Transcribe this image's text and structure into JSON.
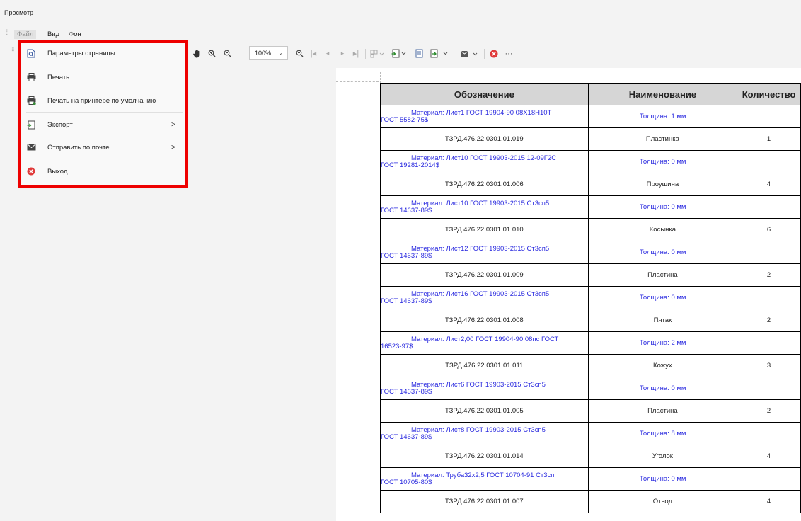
{
  "window": {
    "title": "Просмотр"
  },
  "menubar": {
    "file": "Файл",
    "view": "Вид",
    "background": "Фон"
  },
  "toolbar": {
    "zoom": "100%"
  },
  "file_menu": {
    "items": [
      {
        "label": "Параметры страницы...",
        "icon": "page-setup-icon"
      },
      {
        "label": "Печать...",
        "icon": "printer-icon"
      },
      {
        "label": "Печать на принтере по умолчанию",
        "icon": "default-printer-icon"
      },
      {
        "label": "Экспорт",
        "icon": "export-icon",
        "arrow": ">"
      },
      {
        "label": "Отправить по почте",
        "icon": "mail-icon",
        "arrow": ">"
      },
      {
        "label": "Выход",
        "icon": "exit-icon"
      }
    ]
  },
  "report": {
    "headers": {
      "designation": "Обозначение",
      "name": "Наименование",
      "quantity": "Количество"
    },
    "rows": [
      {
        "type": "material",
        "line1": "Материал: Лист1 ГОСТ 19904-90 08Х18Н10Т",
        "line2": "ГОСТ 5582-75$",
        "thickness": "Толщина: 1 мм"
      },
      {
        "type": "item",
        "code": "ТЗРД.476.22.0301.01.019",
        "name": "Пластинка",
        "qty": "1"
      },
      {
        "type": "material",
        "line1": "Материал: Лист10 ГОСТ 19903-2015 12-09Г2С",
        "line2": "ГОСТ 19281-2014$",
        "thickness": "Толщина: 0 мм"
      },
      {
        "type": "item",
        "code": "ТЗРД.476.22.0301.01.006",
        "name": "Проушина",
        "qty": "4"
      },
      {
        "type": "material",
        "line1": "Материал: Лист10 ГОСТ 19903-2015 Ст3сп5",
        "line2": "ГОСТ 14637-89$",
        "thickness": "Толщина: 0 мм"
      },
      {
        "type": "item",
        "code": "ТЗРД.476.22.0301.01.010",
        "name": "Косынка",
        "qty": "6"
      },
      {
        "type": "material",
        "line1": "Материал: Лист12 ГОСТ 19903-2015 Ст3сп5",
        "line2": "ГОСТ 14637-89$",
        "thickness": "Толщина: 0 мм"
      },
      {
        "type": "item",
        "code": "ТЗРД.476.22.0301.01.009",
        "name": "Пластина",
        "qty": "2"
      },
      {
        "type": "material",
        "line1": "Материал: Лист16 ГОСТ 19903-2015 Ст3сп5",
        "line2": "ГОСТ 14637-89$",
        "thickness": "Толщина: 0 мм"
      },
      {
        "type": "item",
        "code": "ТЗРД.476.22.0301.01.008",
        "name": "Пятак",
        "qty": "2"
      },
      {
        "type": "material",
        "line1": "Материал: Лист2,00 ГОСТ 19904-90 08пс ГОСТ",
        "line2": "16523-97$",
        "thickness": "Толщина: 2 мм"
      },
      {
        "type": "item",
        "code": "ТЗРД.476.22.0301.01.011",
        "name": "Кожух",
        "qty": "3"
      },
      {
        "type": "material",
        "line1": "Материал: Лист6 ГОСТ 19903-2015 Ст3сп5",
        "line2": "ГОСТ 14637-89$",
        "thickness": "Толщина: 0 мм"
      },
      {
        "type": "item",
        "code": "ТЗРД.476.22.0301.01.005",
        "name": "Пластина",
        "qty": "2"
      },
      {
        "type": "material",
        "line1": "Материал: Лист8 ГОСТ 19903-2015 Ст3сп5",
        "line2": "ГОСТ 14637-89$",
        "thickness": "Толщина: 8 мм"
      },
      {
        "type": "item",
        "code": "ТЗРД.476.22.0301.01.014",
        "name": "Уголок",
        "qty": "4"
      },
      {
        "type": "material",
        "line1": "Материал: Труба32х2,5 ГОСТ 10704-91 Ст3сп",
        "line2": "ГОСТ 10705-80$",
        "thickness": "Толщина: 0 мм"
      },
      {
        "type": "item",
        "code": "ТЗРД.476.22.0301.01.007",
        "name": "Отвод",
        "qty": "4"
      }
    ]
  },
  "colors": {
    "highlight": "#ee0000",
    "material_text": "#2a2adf",
    "header_bg": "#d6d6d6",
    "exit_icon": "#e03a3a",
    "stop_icon": "#e03a3a"
  }
}
